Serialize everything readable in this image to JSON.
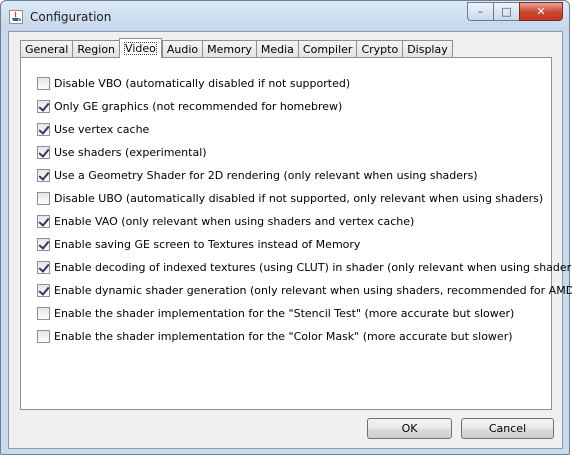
{
  "window": {
    "title": "Configuration",
    "minimize_label": "–",
    "maximize_label": "□",
    "close_label": "✕"
  },
  "tabs": [
    {
      "label": "General"
    },
    {
      "label": "Region"
    },
    {
      "label": "Video",
      "active": true
    },
    {
      "label": "Audio"
    },
    {
      "label": "Memory"
    },
    {
      "label": "Media"
    },
    {
      "label": "Compiler"
    },
    {
      "label": "Crypto"
    },
    {
      "label": "Display"
    }
  ],
  "options": [
    {
      "label": "Disable VBO (automatically disabled if not supported)",
      "checked": false
    },
    {
      "label": "Only GE graphics (not recommended for homebrew)",
      "checked": true
    },
    {
      "label": "Use vertex cache",
      "checked": true
    },
    {
      "label": "Use shaders (experimental)",
      "checked": true
    },
    {
      "label": "Use a Geometry Shader for 2D rendering (only relevant when using shaders)",
      "checked": true
    },
    {
      "label": "Disable UBO (automatically disabled if not supported, only relevant when using shaders)",
      "checked": false
    },
    {
      "label": "Enable VAO (only relevant when using shaders and vertex cache)",
      "checked": true
    },
    {
      "label": "Enable saving GE screen to Textures instead of Memory",
      "checked": true
    },
    {
      "label": "Enable decoding of indexed textures (using CLUT) in shader (only relevant when using shaders)",
      "checked": true
    },
    {
      "label": "Enable dynamic shader generation (only relevant when using shaders, recommended for AMD/ATI)",
      "checked": true
    },
    {
      "label": "Enable the shader implementation for the \"Stencil Test\" (more accurate but slower)",
      "checked": false
    },
    {
      "label": "Enable the shader implementation for the \"Color Mask\" (more accurate but slower)",
      "checked": false
    }
  ],
  "buttons": {
    "ok": "OK",
    "cancel": "Cancel"
  }
}
